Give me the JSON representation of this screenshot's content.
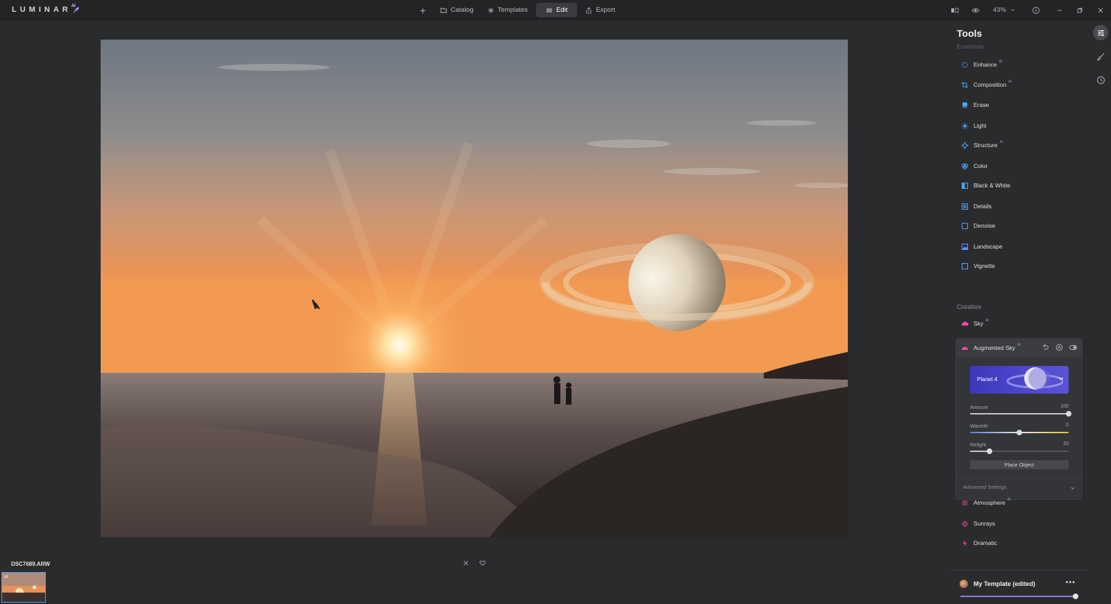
{
  "app": {
    "logo_text": "LUMINAR",
    "logo_sup": "AI"
  },
  "topnav": {
    "add_label": "+",
    "catalog_label": "Catalog",
    "templates_label": "Templates",
    "edit_label": "Edit",
    "export_label": "Export",
    "zoom": "43%"
  },
  "panel": {
    "title": "Tools",
    "essentials_label": "Essentials",
    "essentials": [
      {
        "label": "Enhance",
        "ai": "AI",
        "icon": "enhance-icon",
        "color": "#4aa3ff"
      },
      {
        "label": "Composition",
        "ai": "AI",
        "icon": "composition-icon",
        "color": "#4aa3ff"
      },
      {
        "label": "Erase",
        "ai": "",
        "icon": "erase-icon",
        "color": "#4aa3ff"
      },
      {
        "label": "Light",
        "ai": "",
        "icon": "light-icon",
        "color": "#4aa3ff"
      },
      {
        "label": "Structure",
        "ai": "AI",
        "icon": "structure-icon",
        "color": "#4aa3ff"
      },
      {
        "label": "Color",
        "ai": "",
        "icon": "color-icon",
        "color": "#4aa3ff"
      },
      {
        "label": "Black & White",
        "ai": "",
        "icon": "black-white-icon",
        "color": "#4aa3ff"
      },
      {
        "label": "Details",
        "ai": "",
        "icon": "details-icon",
        "color": "#4aa3ff"
      },
      {
        "label": "Denoise",
        "ai": "",
        "icon": "denoise-icon",
        "color": "#4aa3ff"
      },
      {
        "label": "Landscape",
        "ai": "",
        "icon": "landscape-icon",
        "color": "#4aa3ff"
      },
      {
        "label": "Vignette",
        "ai": "",
        "icon": "vignette-icon",
        "color": "#4aa3ff"
      }
    ],
    "creative_label": "Creative",
    "sky": {
      "label": "Sky",
      "ai": "AI",
      "icon": "sky-icon",
      "color": "#e84aa6"
    },
    "augmented_sky": {
      "label": "Augmented Sky",
      "ai": "AI",
      "object_name": "Planet 4",
      "sliders": [
        {
          "label": "Amount",
          "value": "100",
          "fraction": 1.0,
          "style": "plain"
        },
        {
          "label": "Warmth",
          "value": "0",
          "fraction": 0.5,
          "style": "warm"
        },
        {
          "label": "Relight",
          "value": "20",
          "fraction": 0.2,
          "style": "plain"
        }
      ],
      "place_object_label": "Place Object",
      "advanced_label": "Advanced Settings"
    },
    "creative_after": [
      {
        "label": "Atmosphere",
        "ai": "AI",
        "icon": "atmosphere-icon",
        "color": "#e84aa6"
      },
      {
        "label": "Sunrays",
        "ai": "",
        "icon": "sunrays-icon",
        "color": "#e84aa6"
      },
      {
        "label": "Dramatic",
        "ai": "",
        "icon": "dramatic-icon",
        "color": "#e84aa6"
      }
    ],
    "template": {
      "name": "My Template (edited)",
      "more": "•••",
      "amount_fraction": 1.0
    }
  },
  "filmstrip": {
    "filename": "DSC7689.ARW"
  }
}
